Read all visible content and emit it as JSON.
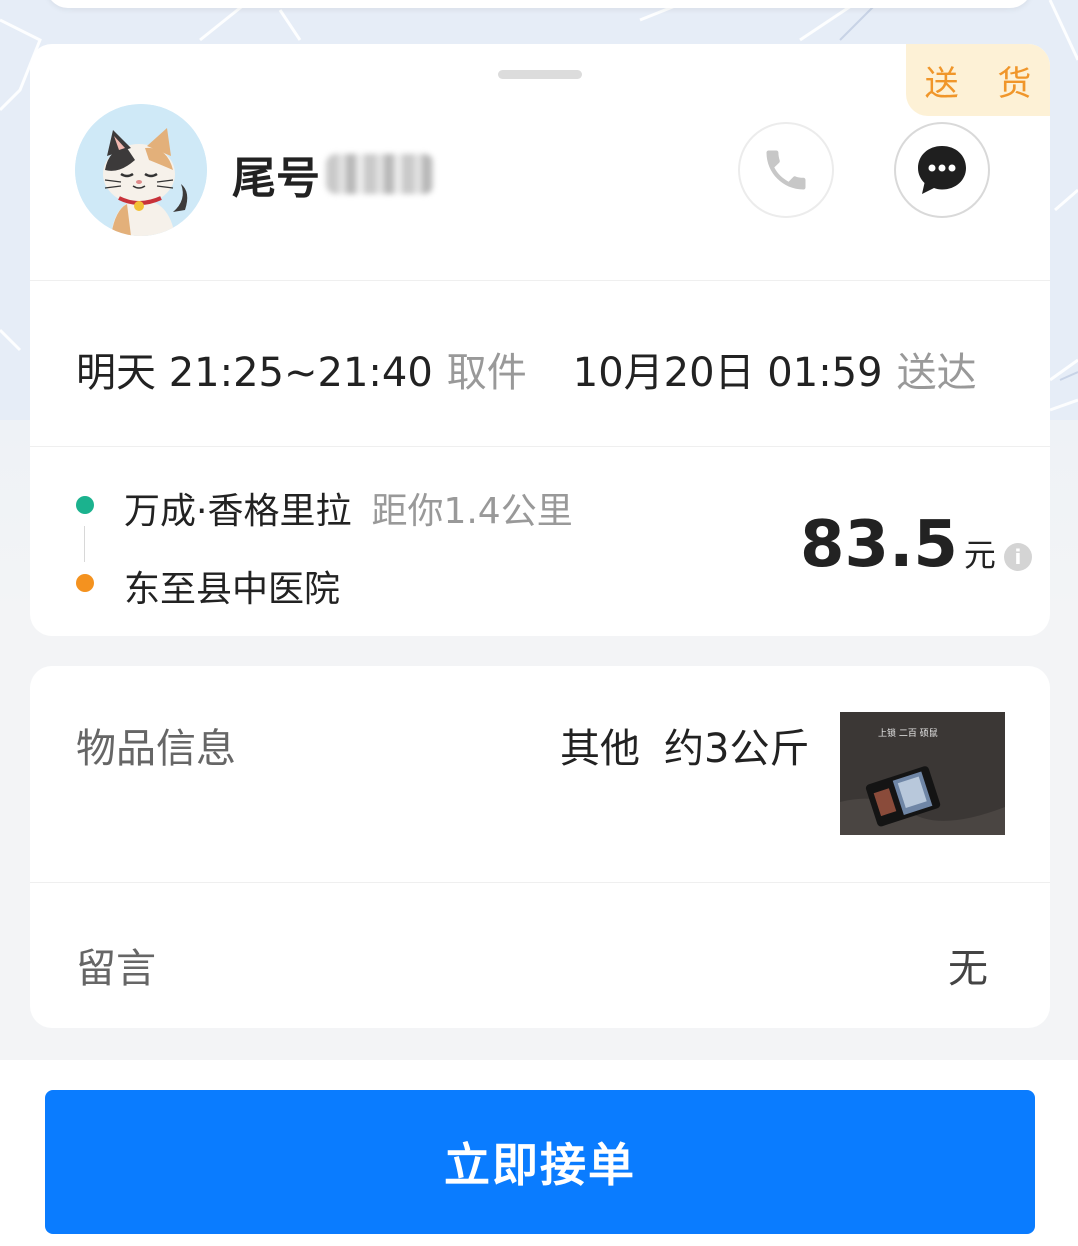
{
  "colors": {
    "accent": "#0a7cff",
    "tag_bg": "#fdf1d6",
    "tag_text": "#f0962a",
    "pickup_dot": "#1bb28e",
    "dropoff_dot": "#f4921f"
  },
  "order": {
    "tag": "送 货",
    "customer_name": "尾号",
    "pickup_time": "明天 21:25~21:40",
    "pickup_label": "取件",
    "delivery_time": "10月20日 01:59",
    "delivery_label": "送达",
    "from_address": "万成·香格里拉",
    "distance": "距你1.4公里",
    "to_address": "东至县中医院",
    "price": "83.5",
    "price_unit": "元",
    "info_icon": "i"
  },
  "goods": {
    "label": "物品信息",
    "category": "其他",
    "weight": "约3公斤",
    "photo_caption": "上锁 二百 硕鼠"
  },
  "message": {
    "label": "留言",
    "value": "无"
  },
  "actions": {
    "accept_label": "立即接单"
  },
  "icons": {
    "phone": "phone-icon",
    "chat": "chat-bubble-icon",
    "info": "info-icon"
  }
}
